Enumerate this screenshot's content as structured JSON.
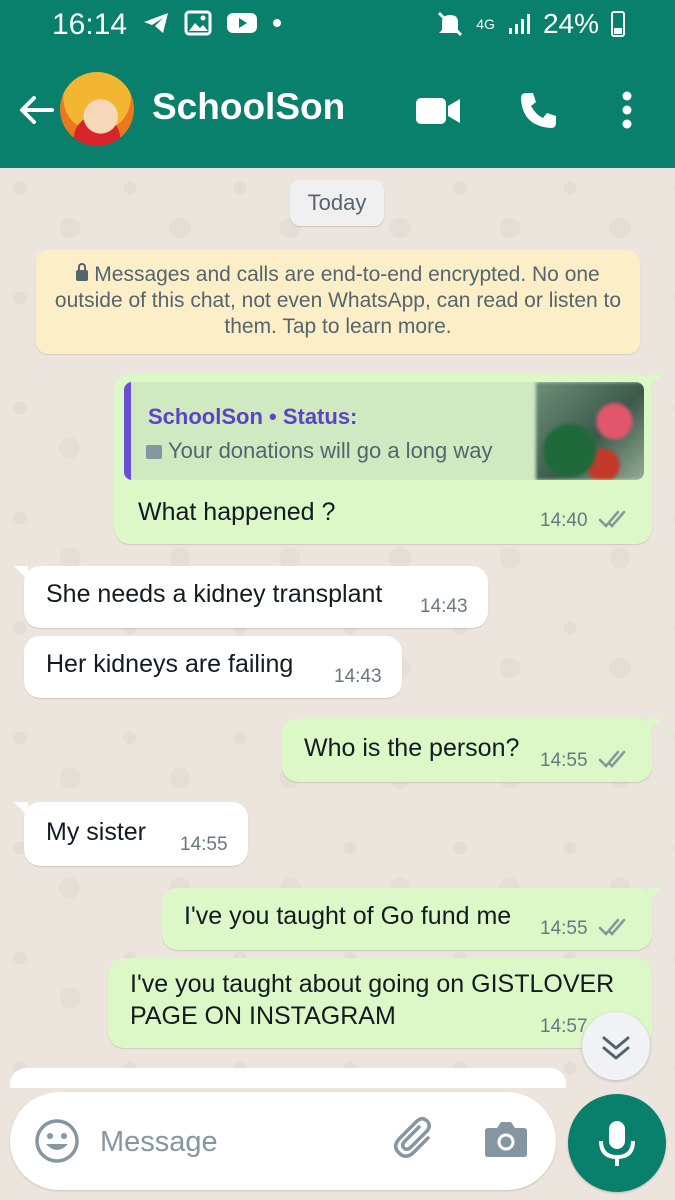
{
  "status_bar": {
    "time": "16:14",
    "network": "4G",
    "battery": "24%"
  },
  "header": {
    "contact_name": "SchoolSon"
  },
  "chat": {
    "date_chip": "Today",
    "encryption_notice": "Messages and calls are end-to-end encrypted. No one outside of this chat, not even WhatsApp, can read or listen to them. Tap to learn more.",
    "status_reply": {
      "sender": "SchoolSon • Status:",
      "caption": "Your donations will go a long way"
    },
    "messages": [
      {
        "direction": "out",
        "text": "What happened ?",
        "time": "14:40"
      },
      {
        "direction": "in",
        "text": "She needs a kidney transplant",
        "time": "14:43"
      },
      {
        "direction": "in",
        "text": "Her kidneys are failing",
        "time": "14:43"
      },
      {
        "direction": "out",
        "text": "Who is the person?",
        "time": "14:55"
      },
      {
        "direction": "in",
        "text": "My sister",
        "time": "14:55"
      },
      {
        "direction": "out",
        "text": "I've you taught of Go fund me",
        "time": "14:55"
      },
      {
        "direction": "out",
        "text_line1": "I've you taught about going on GISTLOVER",
        "text_line2": "PAGE ON INSTAGRAM",
        "time": "14:57"
      }
    ]
  },
  "composer": {
    "placeholder": "Message"
  },
  "colors": {
    "header": "#08806B",
    "outgoing_bubble": "#DCF8C6",
    "incoming_bubble": "#FFFFFF",
    "chat_background": "#ECE5DD",
    "read_ticks": "#8696A0"
  }
}
